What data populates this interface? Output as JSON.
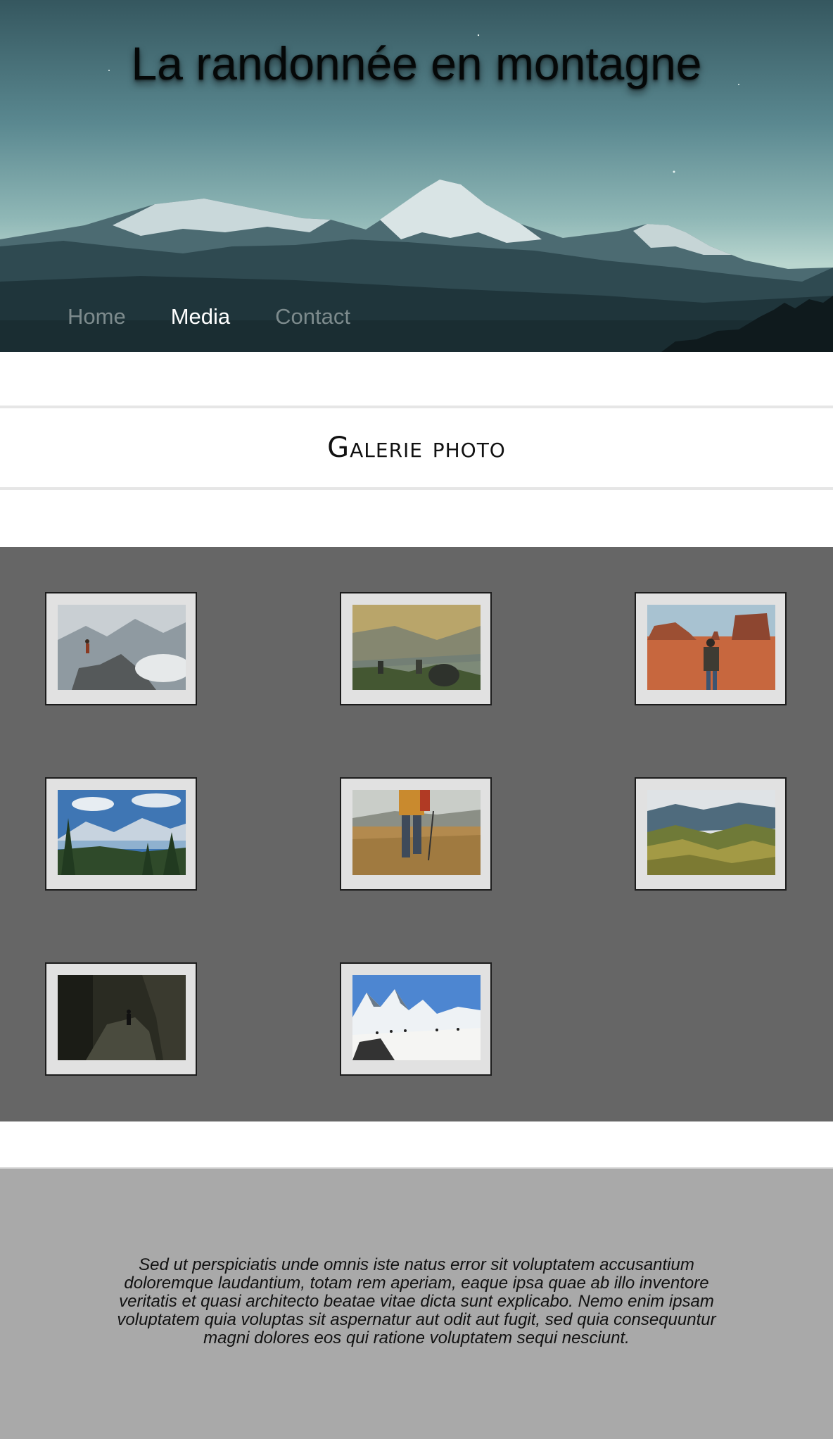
{
  "header": {
    "title": "La randonnée en montagne",
    "nav": [
      {
        "label": "Home",
        "active": false
      },
      {
        "label": "Media",
        "active": true
      },
      {
        "label": "Contact",
        "active": false
      }
    ]
  },
  "gallery": {
    "heading": "Galerie photo"
  },
  "footer": {
    "text": "Sed ut perspiciatis unde omnis iste natus error sit voluptatem accusantium doloremque laudantium, totam rem aperiam, eaque ipsa quae ab illo inventore veritatis et quasi architecto beatae vitae dicta sunt explicabo. Nemo enim ipsam voluptatem quia voluptas sit aspernatur aut odit aut fugit, sed quia consequuntur magni dolores eos qui ratione voluptatem sequi nesciunt."
  },
  "colors": {
    "gallery_bg": "#666666",
    "footer_bg": "#a9a9a9",
    "nav_active": "#ffffff",
    "nav_inactive": "#7d8b8d"
  }
}
